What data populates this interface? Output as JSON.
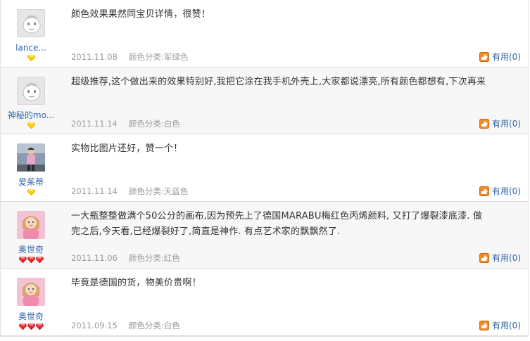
{
  "reviews": [
    {
      "user": "lance...",
      "avatar": "default-face-icon",
      "rank": [
        "yellow-diamond"
      ],
      "content": "颜色效果果然同宝贝详情，很赞！",
      "date": "2011.11.08",
      "color_label": "颜色分类:军绿色",
      "useful_label": "有用",
      "useful_count": "(0)"
    },
    {
      "user": "神秘的mo...",
      "avatar": "default-face-icon",
      "rank": [
        "yellow-diamond"
      ],
      "content": "超级推荐,这个做出来的效果特别好,我把它涂在我手机外壳上,大家都说漂亮,所有颜色都想有,下次再来",
      "date": "2011.11.14",
      "color_label": "颜色分类:白色",
      "useful_label": "有用",
      "useful_count": "(0)"
    },
    {
      "user": "爱茱蒂",
      "avatar": "photo-person-icon",
      "rank": [
        "yellow-diamond"
      ],
      "content": "实物比图片还好，赞一个！",
      "date": "2011.11.14",
      "color_label": "颜色分类:天蓝色",
      "useful_label": "有用",
      "useful_count": "(0)"
    },
    {
      "user": "奥世奇",
      "avatar": "photo-girl-icon",
      "rank": [
        "red-diamond",
        "red-diamond",
        "red-diamond"
      ],
      "content": "一大瓶整整做满个50公分的画布,因为预先上了德国MARABU梅红色丙烯颜料, 又打了爆裂漆底漆. 做完之后,今天看,已经爆裂好了,简直是神作. 有点艺术家的飘飘然了.",
      "date": "2011.11.06",
      "color_label": "颜色分类:红色",
      "useful_label": "有用",
      "useful_count": "(0)"
    },
    {
      "user": "奥世奇",
      "avatar": "photo-girl-icon",
      "rank": [
        "red-diamond",
        "red-diamond",
        "red-diamond"
      ],
      "content": "毕竟是德国的货，物美价贵啊！",
      "date": "2011.09.15",
      "color_label": "颜色分类:白色",
      "useful_label": "有用",
      "useful_count": "(0)"
    }
  ],
  "colors": {
    "link": "#3366aa",
    "meta": "#999999",
    "alt_row_bg": "#f7f7f7",
    "useful_icon": "#f08a24"
  }
}
